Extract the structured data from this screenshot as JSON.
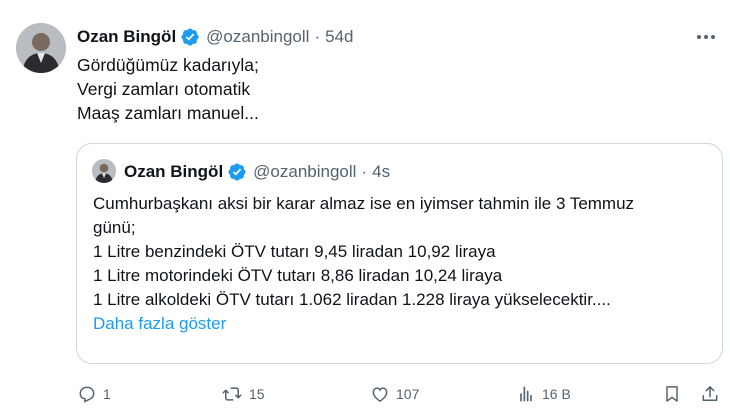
{
  "tweet": {
    "author_name": "Ozan Bingöl",
    "handle": "@ozanbingoll",
    "separator": "·",
    "time": "54d",
    "lines": [
      "Gördüğümüz kadarıyla;",
      "Vergi zamları otomatik",
      "Maaş zamları manuel..."
    ]
  },
  "quote": {
    "author_name": "Ozan Bingöl",
    "handle": "@ozanbingoll",
    "separator": "·",
    "time": "4s",
    "lines": [
      "Cumhurbaşkanı aksi bir karar almaz ise en iyimser tahmin ile 3 Temmuz",
      "günü;",
      "1 Litre benzindeki ÖTV tutarı 9,45 liradan 10,92 liraya",
      "1 Litre motorindeki ÖTV tutarı 8,86 liradan 10,24 liraya",
      "1 Litre alkoldeki ÖTV tutarı 1.062 liradan 1.228 liraya yükselecektir...."
    ],
    "show_more": "Daha fazla göster"
  },
  "actions": {
    "replies": "1",
    "retweets": "15",
    "likes": "107",
    "views": "16 B",
    "bookmark_icon": "bookmark-icon",
    "share_icon": "share-icon"
  },
  "colors": {
    "verified": "#1d9bf0",
    "muted": "#536471",
    "link": "#1d9bf0",
    "border": "#cfd9de"
  }
}
